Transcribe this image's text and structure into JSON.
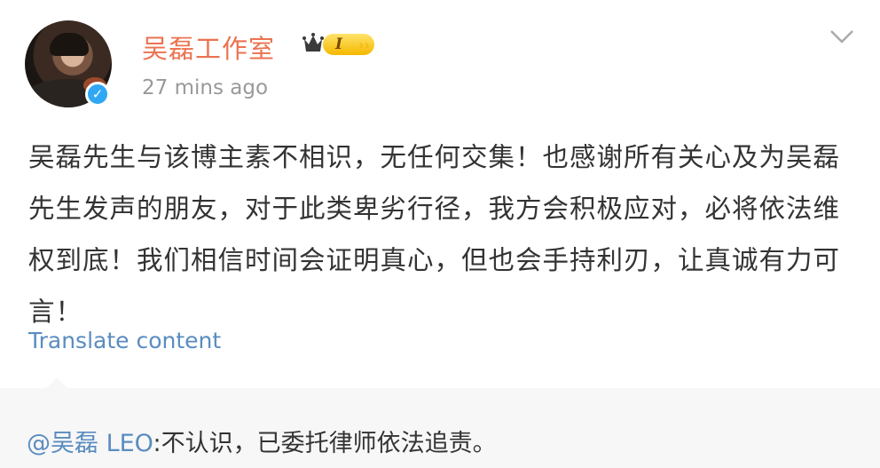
{
  "post": {
    "username": "吴磊工作室",
    "level": "I",
    "timestamp": "27 mins ago",
    "content": "吴磊先生与该博主素不相识，无任何交集！也感谢所有关心及为吴磊先生发声的朋友，对于此类卑劣行径，我方会积极应对，必将依法维权到底！我们相信时间会证明真心，但也会手持利刃，让真诚有力可言！",
    "translate_label": "Translate content"
  },
  "retweet": {
    "mention": "@吴磊 LEO",
    "text": ":不认识，已委托律师依法追责。"
  },
  "colors": {
    "username": "#eb7350",
    "link": "#5a8cc0",
    "verified": "#2fa7f5",
    "badge": "#f5b800"
  },
  "icons": {
    "verified": "verified-badge-icon",
    "crown": "crown-icon",
    "more": "chevron-down-icon"
  }
}
